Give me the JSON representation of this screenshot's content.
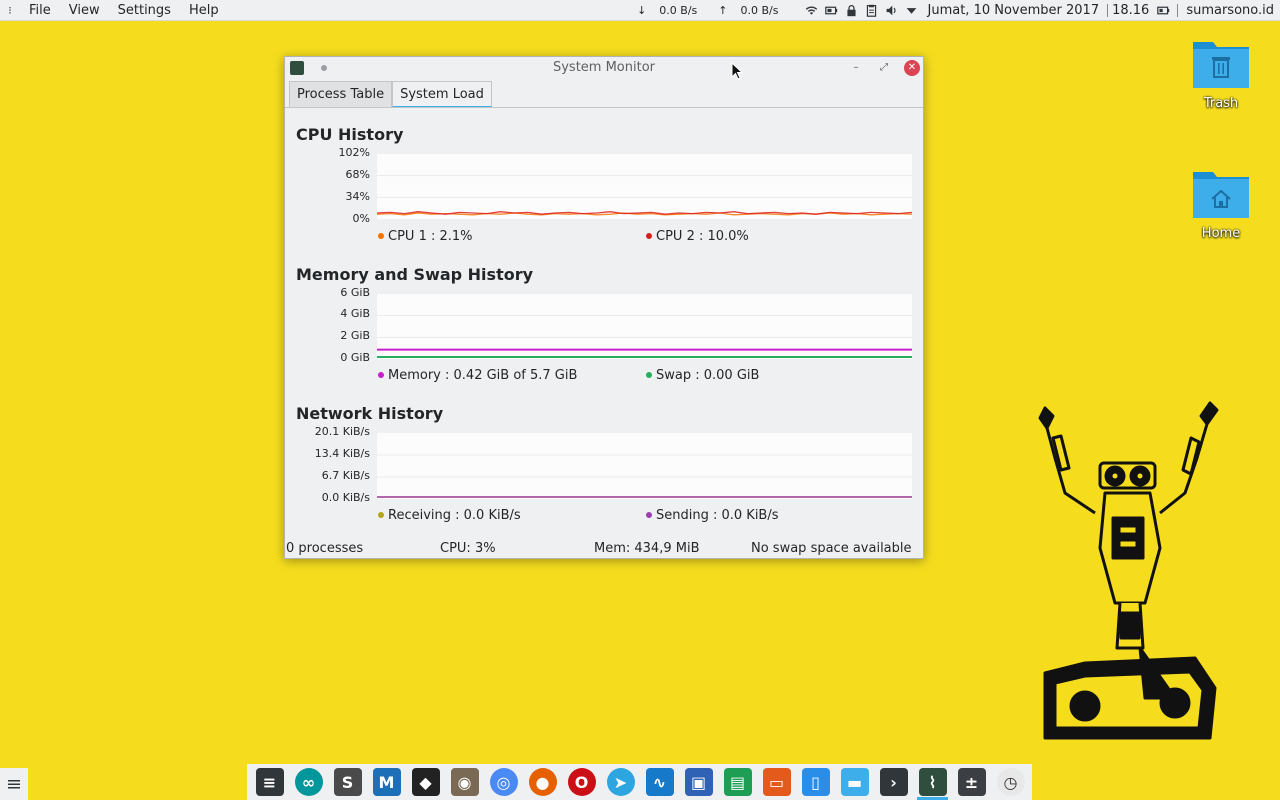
{
  "top_panel": {
    "menus": [
      "File",
      "View",
      "Settings",
      "Help"
    ],
    "net_down_arrow": "↓",
    "net_down": "0.0 B/s",
    "net_up_arrow": "↑",
    "net_up": "0.0 B/s",
    "date": "Jumat, 10 November 2017",
    "time": "18.16",
    "hostname": "sumarsono.id"
  },
  "desktop": {
    "icons": [
      {
        "label": "Trash",
        "icon": "trash-icon"
      },
      {
        "label": "Home",
        "icon": "home-icon"
      }
    ]
  },
  "window": {
    "title": "System Monitor",
    "tabs": [
      {
        "label": "Process Table",
        "active": false
      },
      {
        "label": "System Load",
        "active": true
      }
    ],
    "cpu": {
      "title": "CPU History",
      "y_ticks": [
        "102%",
        "68%",
        "34%",
        "0%"
      ],
      "legend": [
        {
          "label": "CPU 1 : 2.1%",
          "color": "#f67400"
        },
        {
          "label": "CPU 2 : 10.0%",
          "color": "#da1e1e"
        }
      ]
    },
    "memory": {
      "title": "Memory and Swap History",
      "y_ticks": [
        "6 GiB",
        "4 GiB",
        "2 GiB",
        "0 GiB"
      ],
      "legend": [
        {
          "label": "Memory : 0.42 GiB of 5.7 GiB",
          "color": "#c81ecd"
        },
        {
          "label": "Swap : 0.00 GiB",
          "color": "#27ae60"
        }
      ]
    },
    "network": {
      "title": "Network History",
      "y_ticks": [
        "20.1 KiB/s",
        "13.4 KiB/s",
        "6.7 KiB/s",
        "0.0 KiB/s"
      ],
      "legend": [
        {
          "label": "Receiving : 0.0 KiB/s",
          "color": "#b5a31e"
        },
        {
          "label": "Sending : 0.0 KiB/s",
          "color": "#9b3eb4"
        }
      ]
    },
    "status": {
      "processes": "0 processes",
      "cpu": "CPU: 3%",
      "mem": "Mem: 434,9 MiB",
      "swap": "No swap space available"
    }
  },
  "chart_data": [
    {
      "type": "line",
      "title": "CPU History",
      "ylim": [
        0,
        102
      ],
      "series": [
        {
          "name": "CPU 1",
          "current": 2.1,
          "values": [
            3,
            4,
            2,
            5,
            3,
            4,
            3,
            2,
            4,
            3,
            5,
            3,
            2,
            4,
            3,
            4,
            2,
            3,
            5,
            3,
            4,
            2,
            3,
            4,
            3,
            5,
            2,
            3,
            4,
            3,
            2,
            4,
            3,
            5,
            3,
            4,
            2,
            3,
            4,
            3
          ]
        },
        {
          "name": "CPU 2",
          "current": 10.0,
          "values": [
            5,
            6,
            4,
            7,
            5,
            3,
            6,
            5,
            4,
            7,
            5,
            6,
            3,
            5,
            6,
            4,
            5,
            7,
            4,
            5,
            6,
            3,
            5,
            4,
            6,
            5,
            7,
            4,
            5,
            6,
            4,
            5,
            3,
            6,
            5,
            4,
            6,
            5,
            4,
            6
          ]
        }
      ]
    },
    {
      "type": "line",
      "title": "Memory and Swap History",
      "ylim": [
        0,
        6
      ],
      "series": [
        {
          "name": "Memory",
          "current": 0.42
        },
        {
          "name": "Swap",
          "current": 0.0
        }
      ]
    },
    {
      "type": "line",
      "title": "Network History",
      "ylim": [
        0,
        20.1
      ],
      "series": [
        {
          "name": "Receiving",
          "current": 0.0
        },
        {
          "name": "Sending",
          "current": 0.0
        }
      ]
    }
  ],
  "dock": {
    "items": [
      {
        "icon": "system-settings-icon",
        "color": "#31363b"
      },
      {
        "icon": "arduino-icon",
        "color": "#00979c"
      },
      {
        "icon": "sublime-text-icon",
        "color": "#4a4a4a"
      },
      {
        "icon": "writer-m-icon",
        "color": "#1d6fb8"
      },
      {
        "icon": "inkscape-icon",
        "color": "#222222"
      },
      {
        "icon": "gimp-icon",
        "color": "#7a6a55"
      },
      {
        "icon": "chromium-icon",
        "color": "#4a8af4"
      },
      {
        "icon": "firefox-icon",
        "color": "#e66000"
      },
      {
        "icon": "opera-icon",
        "color": "#cc0f16"
      },
      {
        "icon": "telegram-icon",
        "color": "#2ca5e0"
      },
      {
        "icon": "wireshark-icon",
        "color": "#1679c9"
      },
      {
        "icon": "virtualbox-icon",
        "color": "#2f61b4"
      },
      {
        "icon": "spreadsheet-icon",
        "color": "#1e9e54"
      },
      {
        "icon": "presentation-icon",
        "color": "#e35a1b"
      },
      {
        "icon": "document-icon",
        "color": "#2a8ee8"
      },
      {
        "icon": "file-manager-icon",
        "color": "#3daee9"
      },
      {
        "icon": "terminal-icon",
        "color": "#31363b"
      },
      {
        "icon": "system-monitor-icon",
        "color": "#2f4e3e",
        "active": true
      },
      {
        "icon": "calculator-icon",
        "color": "#3b3f44"
      },
      {
        "icon": "clock-icon",
        "color": "#e8e8e8"
      }
    ]
  }
}
